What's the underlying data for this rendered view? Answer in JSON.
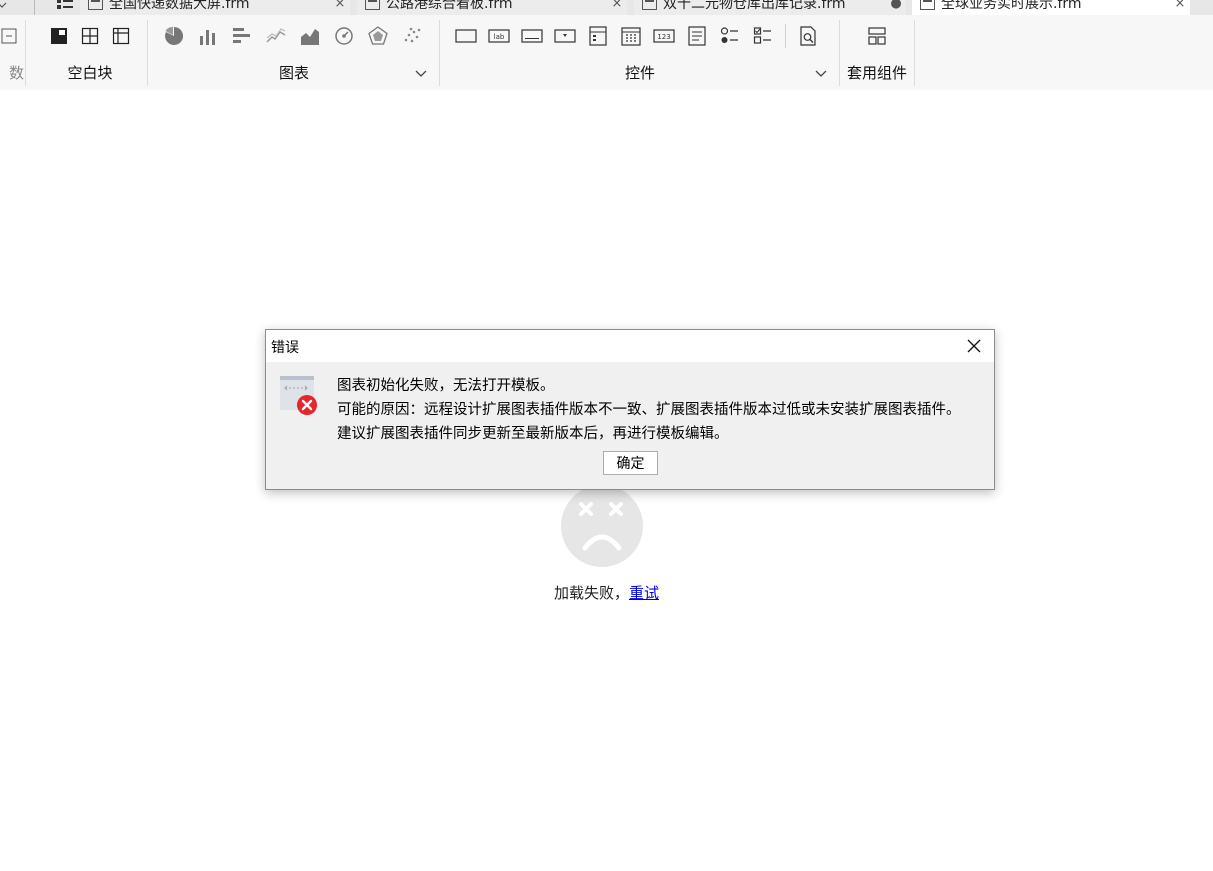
{
  "tabs": [
    {
      "title": "全国快递数据大屏.frm",
      "close": "×"
    },
    {
      "title": "公路港综合看板.frm",
      "close": "×"
    },
    {
      "title": "双十二元物仓库出库记录.frm",
      "close": "●"
    },
    {
      "title": "全球业务实时展示.frm",
      "close": "×"
    }
  ],
  "ribbon": {
    "blank_block_label": "空白块",
    "chart_label": "图表",
    "widget_label": "控件",
    "template_component_label": "套用组件",
    "left_cut_label": "数"
  },
  "content": {
    "load_failed_text": "加载失败，",
    "retry_label": "重试"
  },
  "dialog": {
    "title": "错误",
    "line1": "图表初始化失败，无法打开模板。",
    "line2": "可能的原因：远程设计扩展图表插件版本不一致、扩展图表插件版本过低或未安装扩展图表插件。",
    "line3": "建议扩展图表插件同步更新至最新版本后，再进行模板编辑。",
    "ok_label": "确定"
  },
  "colors": {
    "error_red": "#e8242c",
    "link_blue": "#0000ee",
    "sad_face_gray": "#e6e6e6"
  }
}
